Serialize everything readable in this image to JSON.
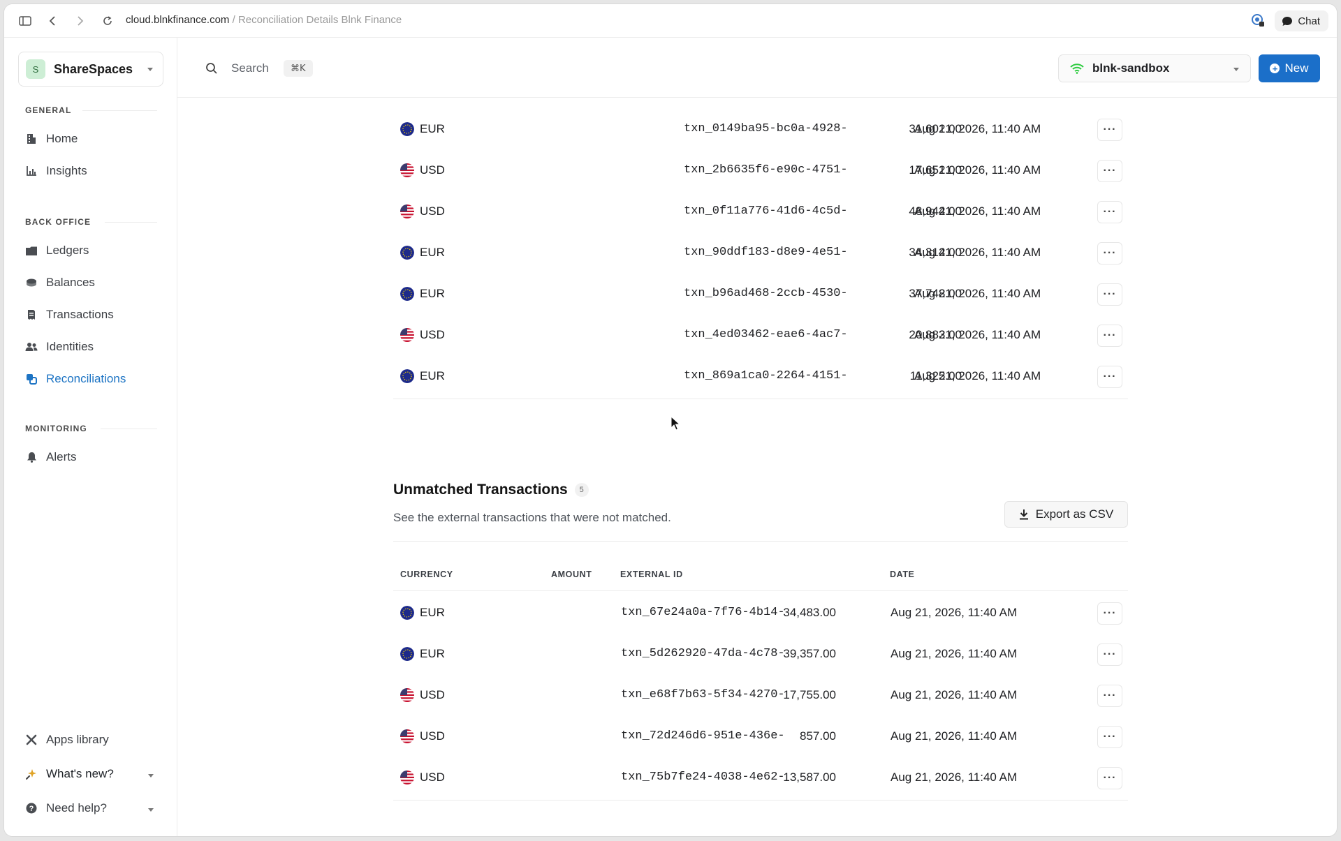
{
  "browser": {
    "domain": "cloud.blnkfinance.com",
    "separator": " / ",
    "page_title": "Reconciliation Details Blnk Finance",
    "chat_label": "Chat"
  },
  "sidebar": {
    "workspace_initial": "S",
    "workspace_name": "ShareSpaces",
    "sections": {
      "general": "GENERAL",
      "back_office": "BACK OFFICE",
      "monitoring": "MONITORING"
    },
    "items": {
      "home": "Home",
      "insights": "Insights",
      "ledgers": "Ledgers",
      "balances": "Balances",
      "transactions": "Transactions",
      "identities": "Identities",
      "reconciliations": "Reconciliations",
      "alerts": "Alerts",
      "apps_library": "Apps library",
      "whats_new": "What's new?",
      "need_help": "Need help?"
    },
    "active_item": "Reconciliations"
  },
  "topbar": {
    "search_label": "Search",
    "search_shortcut": "⌘K",
    "environment": "blnk-sandbox",
    "new_label": "New"
  },
  "matched_rows": [
    {
      "currency": "EUR",
      "amount": "31,601.00",
      "id": "txn_0149ba95-bc0a-4928-",
      "date": "Aug 21, 2026, 11:40 AM"
    },
    {
      "currency": "USD",
      "amount": "17,651.00",
      "id": "txn_2b6635f6-e90c-4751-",
      "date": "Aug 21, 2026, 11:40 AM"
    },
    {
      "currency": "USD",
      "amount": "48,944.00",
      "id": "txn_0f11a776-41d6-4c5d-",
      "date": "Aug 21, 2026, 11:40 AM"
    },
    {
      "currency": "EUR",
      "amount": "34,314.00",
      "id": "txn_90ddf183-d8e9-4e51-",
      "date": "Aug 21, 2026, 11:40 AM"
    },
    {
      "currency": "EUR",
      "amount": "37,748.00",
      "id": "txn_b96ad468-2ccb-4530-",
      "date": "Aug 21, 2026, 11:40 AM"
    },
    {
      "currency": "USD",
      "amount": "20,883.00",
      "id": "txn_4ed03462-eae6-4ac7-",
      "date": "Aug 21, 2026, 11:40 AM"
    },
    {
      "currency": "EUR",
      "amount": "11,325.00",
      "id": "txn_869a1ca0-2264-4151-",
      "date": "Aug 21, 2026, 11:40 AM"
    }
  ],
  "unmatched": {
    "title": "Unmatched Transactions",
    "count": "5",
    "subtitle": "See the external transactions that were not matched.",
    "export_label": "Export as CSV",
    "headers": {
      "currency": "CURRENCY",
      "amount": "AMOUNT",
      "external_id": "EXTERNAL ID",
      "date": "DATE"
    },
    "rows": [
      {
        "currency": "EUR",
        "amount": "34,483.00",
        "id": "txn_67e24a0a-7f76-4b14-",
        "date": "Aug 21, 2026, 11:40 AM"
      },
      {
        "currency": "EUR",
        "amount": "39,357.00",
        "id": "txn_5d262920-47da-4c78-",
        "date": "Aug 21, 2026, 11:40 AM"
      },
      {
        "currency": "USD",
        "amount": "17,755.00",
        "id": "txn_e68f7b63-5f34-4270-",
        "date": "Aug 21, 2026, 11:40 AM"
      },
      {
        "currency": "USD",
        "amount": "857.00",
        "id": "txn_72d246d6-951e-436e-",
        "date": "Aug 21, 2026, 11:40 AM"
      },
      {
        "currency": "USD",
        "amount": "13,587.00",
        "id": "txn_75b7fe24-4038-4e62-",
        "date": "Aug 21, 2026, 11:40 AM"
      }
    ]
  },
  "colors": {
    "accent": "#1b6fc9",
    "active_nav": "#1d74c4",
    "env_status": "#2ecc40"
  }
}
